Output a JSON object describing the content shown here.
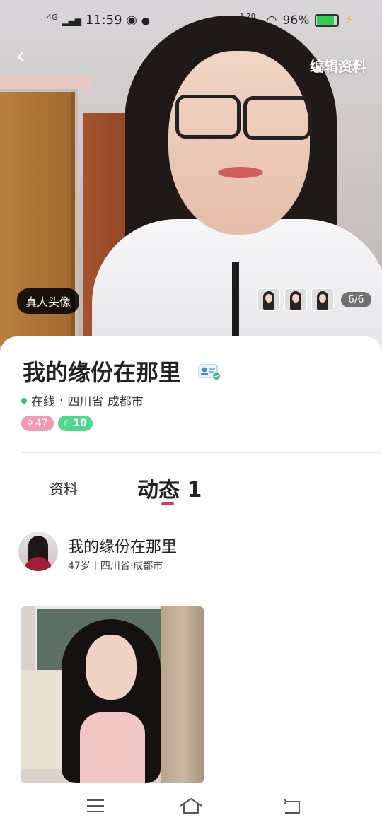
{
  "status_bar": {
    "network": "4G",
    "time": "11:59",
    "speed": "1.70 KB/s",
    "battery": "96%"
  },
  "header": {
    "edit_label": "编辑资料"
  },
  "hero": {
    "real_avatar_badge": "真人头像",
    "photo_counter": "6/6"
  },
  "profile": {
    "nickname": "我的缘份在那里",
    "online_status": "在线",
    "separator": "·",
    "location": "四川省 成都市",
    "tags": {
      "age": "47",
      "moon": "10"
    }
  },
  "tabs": {
    "info": "资料",
    "feed": "动态 1"
  },
  "post": {
    "author": "我的缘份在那里",
    "subtitle": "47岁丨四川省·成都市"
  },
  "colors": {
    "accent_red": "#e8314f",
    "online_green": "#27c56b",
    "tag_pink": "#f29ab4",
    "tag_green": "#4ed98f"
  }
}
